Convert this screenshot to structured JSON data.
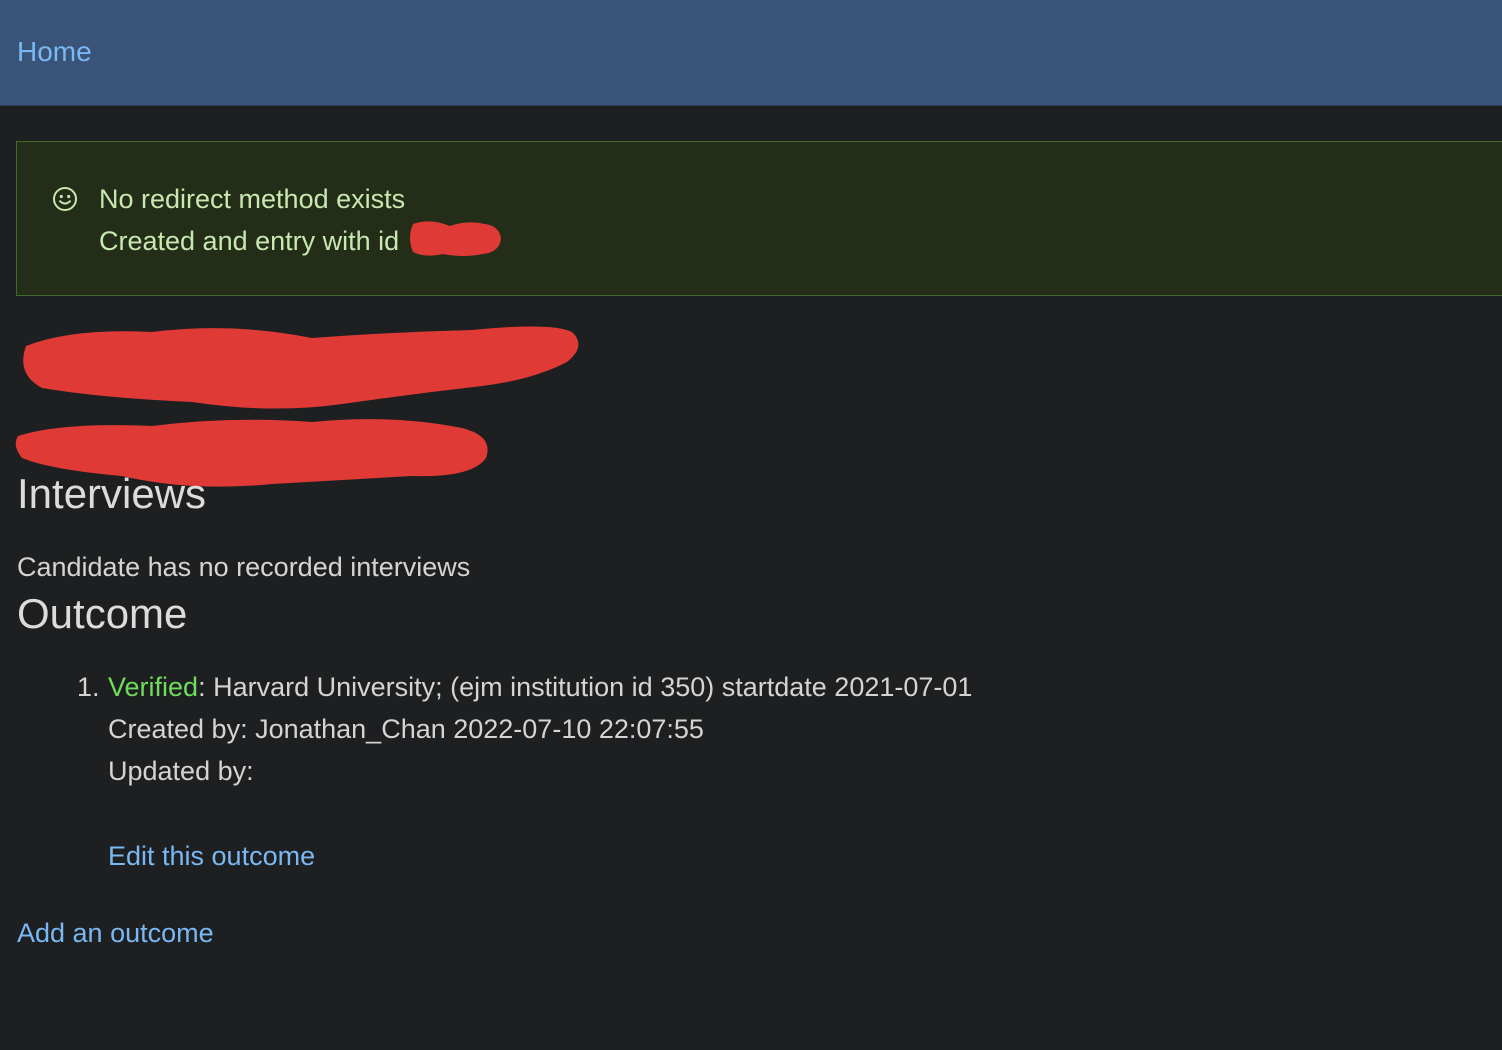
{
  "nav": {
    "home_label": "Home"
  },
  "alert": {
    "icon": "smiley-icon",
    "line1": "No redirect method exists",
    "line2": "Created and entry with id"
  },
  "interviews": {
    "heading": "Interviews",
    "empty_text": "Candidate has no recorded interviews"
  },
  "outcome": {
    "heading": "Outcome",
    "items": [
      {
        "number": "1.",
        "status": "Verified",
        "detail": ": Harvard University; (ejm institution id 350) startdate 2021-07-01",
        "created_by": "Created by: Jonathan_Chan 2022-07-10 22:07:55",
        "updated_by": "Updated by:",
        "edit_label": "Edit this outcome"
      }
    ],
    "add_label": "Add an outcome"
  },
  "colors": {
    "topbar": "#3a5378",
    "background": "#1e1f21",
    "link": "#79b8f3",
    "alert_bg": "#232d17",
    "alert_border": "#3f6a2b",
    "verified": "#6fdc5b",
    "redaction": "#e03a36"
  }
}
